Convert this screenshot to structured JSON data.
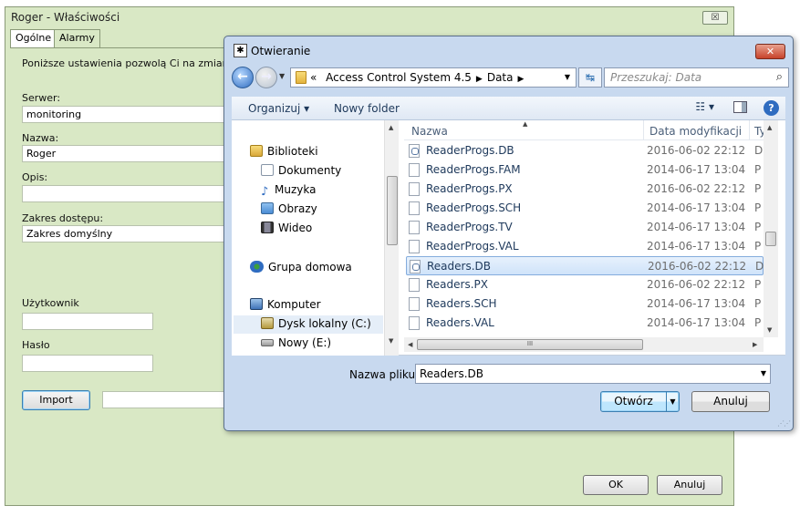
{
  "roger": {
    "title": "Roger - Właściwości",
    "close_symbol": "☒",
    "tabs": [
      "Ogólne",
      "Alarmy"
    ],
    "intro": "Poniższe ustawienia pozwolą Ci na zmianę pod",
    "server_label": "Serwer:",
    "server_value": "monitoring",
    "name_label": "Nazwa:",
    "name_value": "Roger",
    "desc_label": "Opis:",
    "desc_value": "",
    "scope_label": "Zakres dostępu:",
    "scope_value": "Zakres domyślny",
    "user_label": "Użytkownik",
    "user_value": "",
    "password_label": "Hasło",
    "password_value": "",
    "import_label": "Import",
    "import_path": "",
    "ok_label": "OK",
    "cancel_label": "Anuluj"
  },
  "dialog": {
    "title": "Otwieranie",
    "close_symbol": "✕",
    "back_symbol": "←",
    "forward_symbol": "→",
    "breadcrumb_prefix": "«",
    "breadcrumb": [
      "Access Control System 4.5",
      "Data"
    ],
    "refresh_symbol": "↹",
    "search_placeholder": "Przeszukaj: Data",
    "search_symbol": "⌕",
    "organize_label": "Organizuj ▾",
    "new_folder_label": "Nowy folder",
    "views_symbol": "☷ ▾",
    "help_symbol": "?",
    "nav_items": [
      {
        "label": "Biblioteki",
        "icon": "library-icon"
      },
      {
        "label": "Dokumenty",
        "icon": "documents-icon"
      },
      {
        "label": "Muzyka",
        "icon": "music-icon"
      },
      {
        "label": "Obrazy",
        "icon": "pictures-icon"
      },
      {
        "label": "Wideo",
        "icon": "video-icon"
      },
      {
        "label": "Grupa domowa",
        "icon": "homegroup-icon"
      },
      {
        "label": "Komputer",
        "icon": "computer-icon"
      },
      {
        "label": "Dysk lokalny (C:)",
        "icon": "local-disk-icon"
      },
      {
        "label": "Nowy (E:)",
        "icon": "removable-drive-icon"
      }
    ],
    "columns": {
      "name": "Nazwa",
      "modified": "Data modyfikacji",
      "type": "Ty"
    },
    "files": [
      {
        "name": "ReaderProgs.DB",
        "date": "2016-06-02 22:12",
        "type": "D"
      },
      {
        "name": "ReaderProgs.FAM",
        "date": "2014-06-17 13:04",
        "type": "P"
      },
      {
        "name": "ReaderProgs.PX",
        "date": "2016-06-02 22:12",
        "type": "P"
      },
      {
        "name": "ReaderProgs.SCH",
        "date": "2014-06-17 13:04",
        "type": "P"
      },
      {
        "name": "ReaderProgs.TV",
        "date": "2014-06-17 13:04",
        "type": "P"
      },
      {
        "name": "ReaderProgs.VAL",
        "date": "2014-06-17 13:04",
        "type": "P"
      },
      {
        "name": "Readers.DB",
        "date": "2016-06-02 22:12",
        "type": "D"
      },
      {
        "name": "Readers.PX",
        "date": "2016-06-02 22:12",
        "type": "P"
      },
      {
        "name": "Readers.SCH",
        "date": "2014-06-17 13:04",
        "type": "P"
      },
      {
        "name": "Readers.VAL",
        "date": "2014-06-17 13:04",
        "type": "P"
      }
    ],
    "selected_file": "Readers.DB",
    "filename_label": "Nazwa pliku:",
    "filename_value": "Readers.DB",
    "open_label": "Otwórz",
    "cancel_label": "Anuluj",
    "hscroll_grip": "III"
  }
}
